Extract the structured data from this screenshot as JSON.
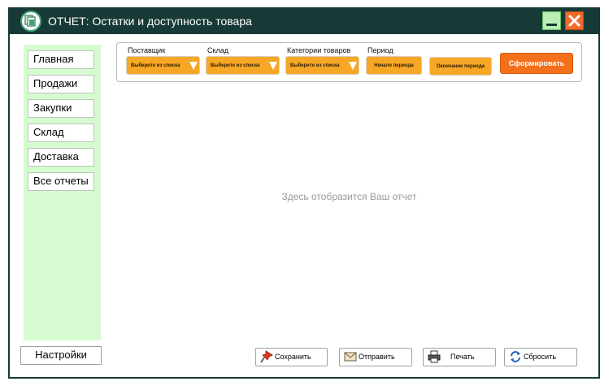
{
  "window": {
    "title": "ОТЧЕТ: Остатки и доступность товара"
  },
  "sidebar": {
    "items": [
      {
        "label": "Главная"
      },
      {
        "label": "Продажи"
      },
      {
        "label": "Закупки"
      },
      {
        "label": "Склад"
      },
      {
        "label": "Доставка"
      },
      {
        "label": "Все отчеты"
      }
    ],
    "settings_label": "Настройки"
  },
  "filters": {
    "supplier": {
      "label": "Поставщик",
      "value": "Выберите из списка"
    },
    "warehouse": {
      "label": "Склад",
      "value": "Выберите из списка"
    },
    "category": {
      "label": "Категории товаров",
      "value": "Выберите из списка"
    },
    "period": {
      "label": "Период",
      "start": "Начало периода",
      "end": "Окончание периода"
    },
    "generate_label": "Сформировать"
  },
  "report": {
    "placeholder": "Здесь отобразится Ваш отчет"
  },
  "actions": {
    "save": {
      "label": "Сохранить",
      "icon": "pin-icon"
    },
    "send": {
      "label": "Отправить",
      "icon": "envelope-icon"
    },
    "print": {
      "label": "Печать",
      "icon": "printer-icon"
    },
    "reset": {
      "label": "Сбросить",
      "icon": "refresh-icon"
    }
  },
  "colors": {
    "titlebar": "#183a36",
    "sidebar": "#d6fbd0",
    "dropdown": "#f6a726",
    "primary_button": "#f4701d",
    "close_button": "#f26a2b",
    "minimize_button": "#b9efb3"
  }
}
